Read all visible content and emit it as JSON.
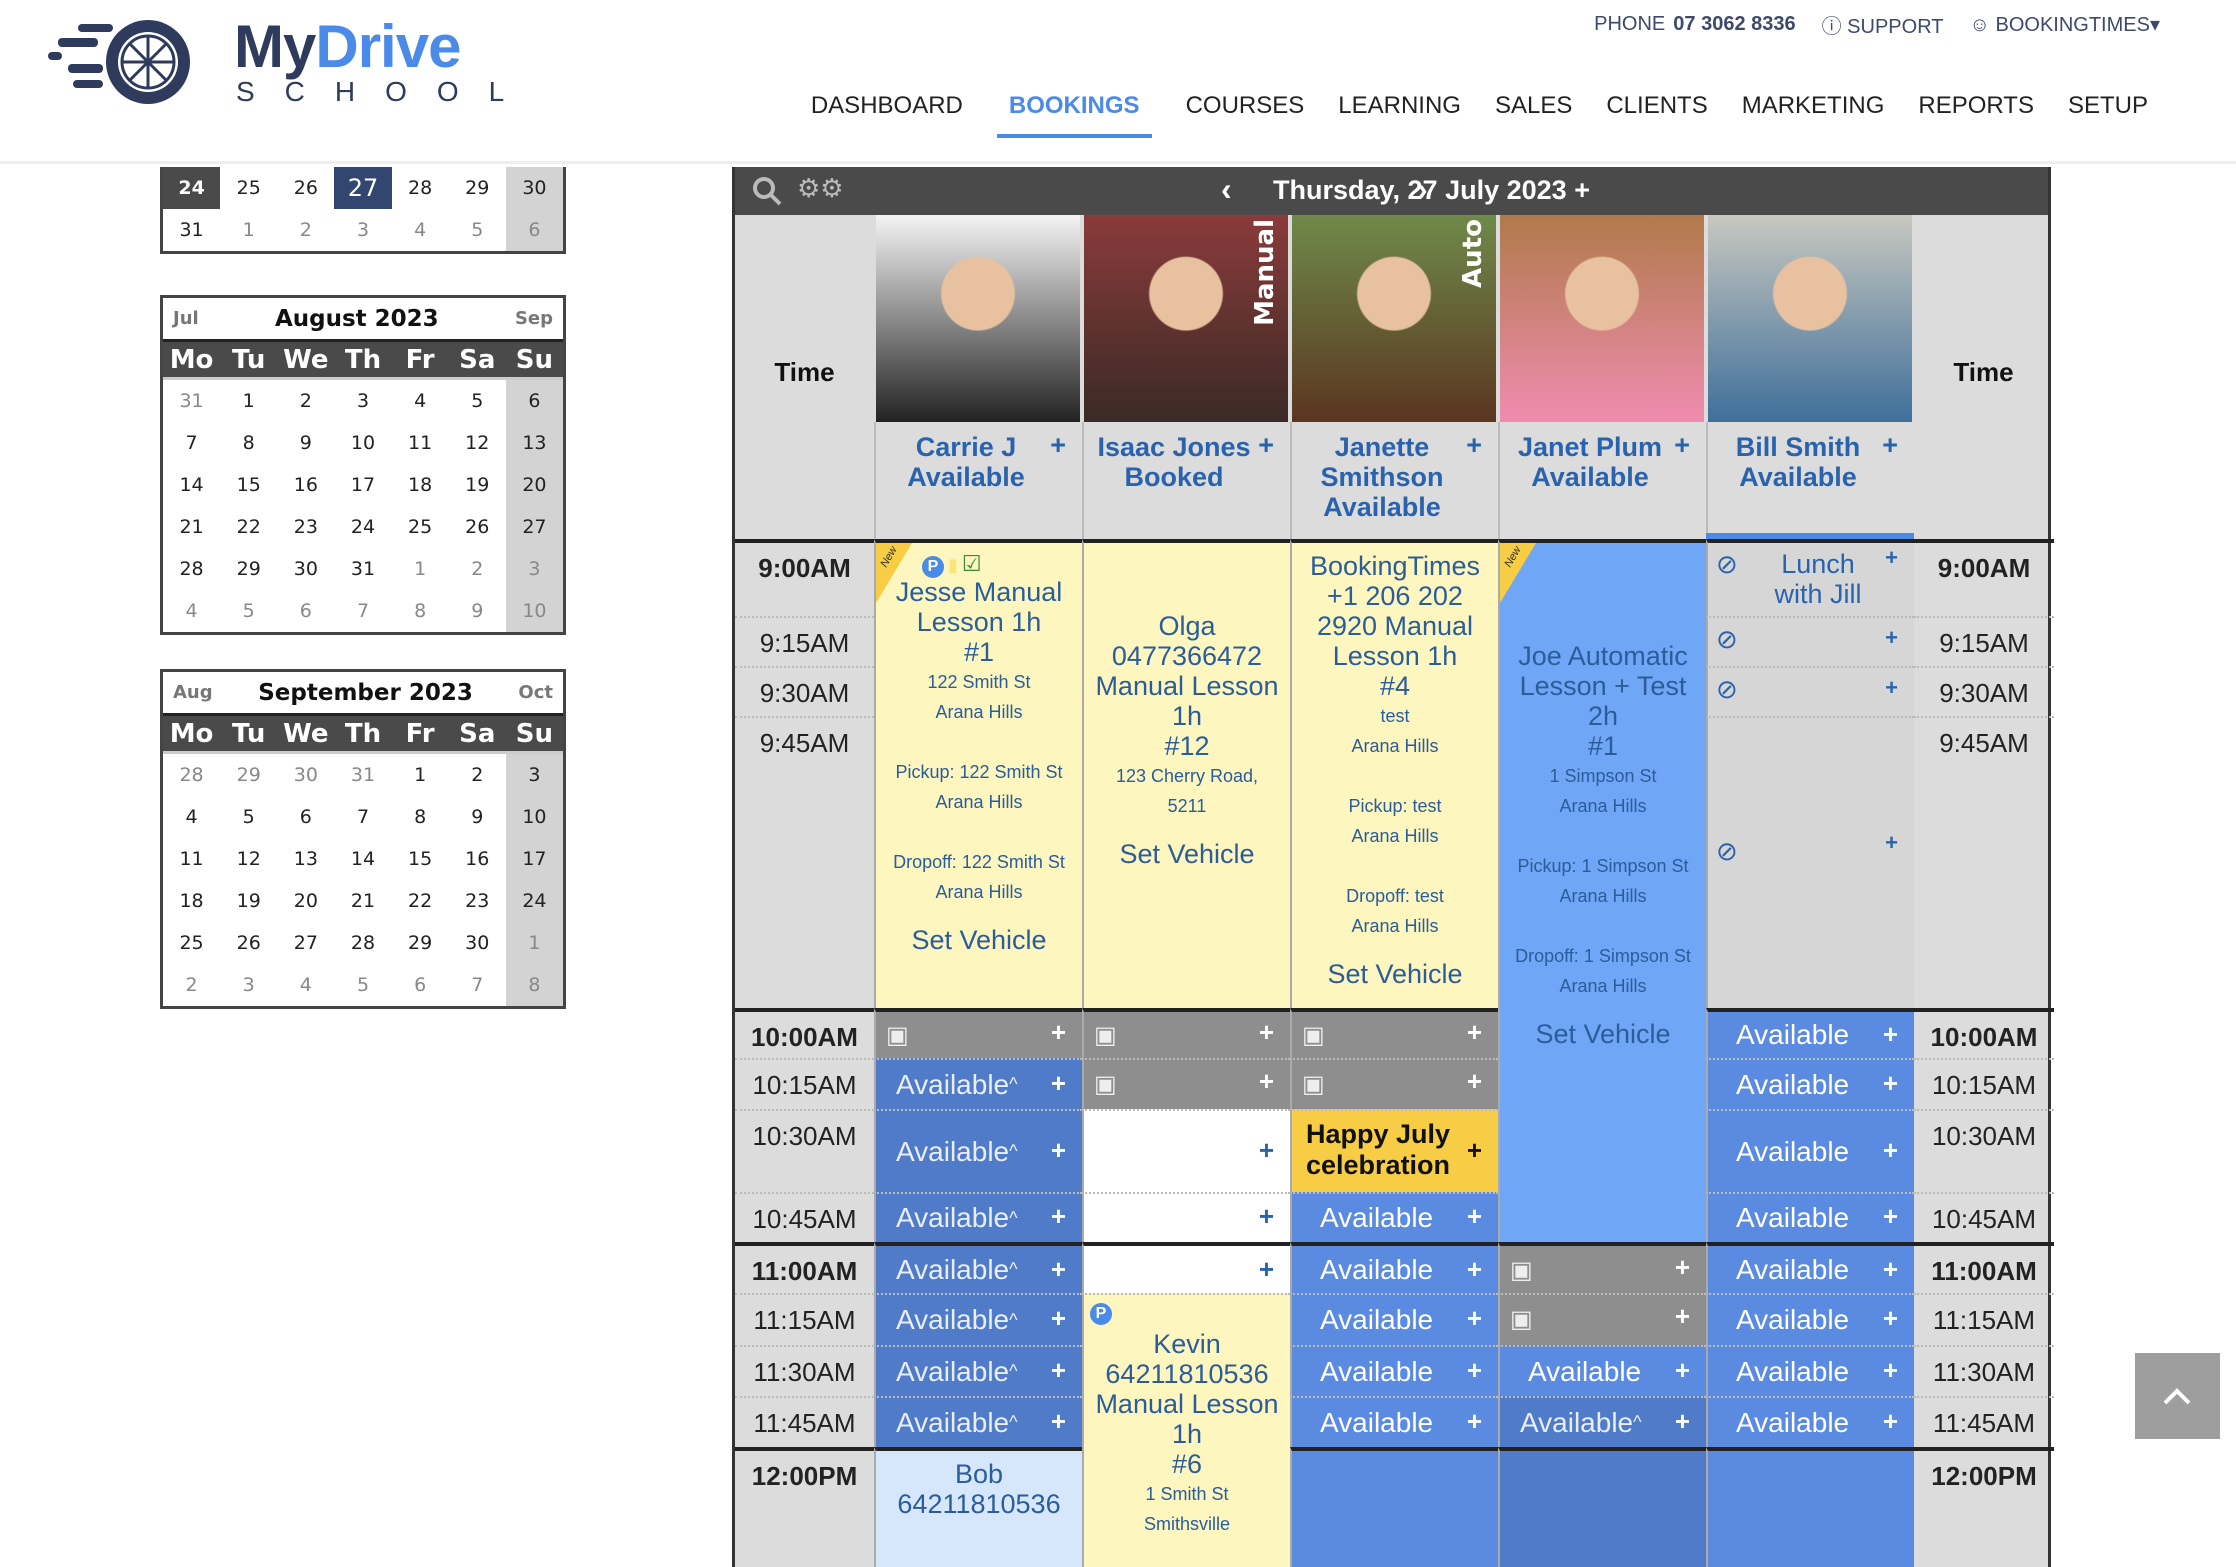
{
  "brand": {
    "name_part1": "My",
    "name_part2": "Drive",
    "subtitle": "SCHOOL",
    "accent": "#4a8ae8",
    "dark": "#2f3b5c"
  },
  "topbar": {
    "phone_label": "PHONE",
    "phone": "07 3062 8336",
    "support": "SUPPORT",
    "account": "BOOKINGTIMES"
  },
  "nav": [
    {
      "label": "DASHBOARD"
    },
    {
      "label": "BOOKINGS",
      "active": true
    },
    {
      "label": "COURSES"
    },
    {
      "label": "LEARNING"
    },
    {
      "label": "SALES"
    },
    {
      "label": "CLIENTS"
    },
    {
      "label": "MARKETING"
    },
    {
      "label": "REPORTS"
    },
    {
      "label": "SETUP"
    }
  ],
  "calendars": [
    {
      "title": "",
      "prev": "",
      "next": "",
      "weekdays": [],
      "weeks": [
        [
          24,
          25,
          26,
          27,
          28,
          29,
          30
        ],
        [
          31,
          1,
          2,
          3,
          4,
          5,
          6
        ]
      ],
      "leading_muted": 0,
      "trailing_muted": 6,
      "selected_week_day": 24,
      "today": 27
    },
    {
      "title": "August 2023",
      "prev": "Jul",
      "next": "Sep",
      "weekdays": [
        "Mo",
        "Tu",
        "We",
        "Th",
        "Fr",
        "Sa",
        "Su"
      ],
      "weeks": [
        [
          31,
          1,
          2,
          3,
          4,
          5,
          6
        ],
        [
          7,
          8,
          9,
          10,
          11,
          12,
          13
        ],
        [
          14,
          15,
          16,
          17,
          18,
          19,
          20
        ],
        [
          21,
          22,
          23,
          24,
          25,
          26,
          27
        ],
        [
          28,
          29,
          30,
          31,
          1,
          2,
          3
        ],
        [
          4,
          5,
          6,
          7,
          8,
          9,
          10
        ]
      ],
      "leading_muted": 1,
      "trailing_muted": 10
    },
    {
      "title": "September 2023",
      "prev": "Aug",
      "next": "Oct",
      "weekdays": [
        "Mo",
        "Tu",
        "We",
        "Th",
        "Fr",
        "Sa",
        "Su"
      ],
      "weeks": [
        [
          28,
          29,
          30,
          31,
          1,
          2,
          3
        ],
        [
          4,
          5,
          6,
          7,
          8,
          9,
          10
        ],
        [
          11,
          12,
          13,
          14,
          15,
          16,
          17
        ],
        [
          18,
          19,
          20,
          21,
          22,
          23,
          24
        ],
        [
          25,
          26,
          27,
          28,
          29,
          30,
          1
        ],
        [
          2,
          3,
          4,
          5,
          6,
          7,
          8
        ]
      ],
      "leading_muted": 4,
      "trailing_muted": 8
    }
  ],
  "scheduler": {
    "date": "Thursday, 27 July 2023",
    "add": "+",
    "time_header": "Time",
    "times": [
      "9:00AM",
      "9:15AM",
      "9:30AM",
      "9:45AM",
      "10:00AM",
      "10:15AM",
      "10:30AM",
      "10:45AM",
      "11:00AM",
      "11:15AM",
      "11:30AM",
      "11:45AM",
      "12:00PM"
    ],
    "hour_times": [
      "9:00AM",
      "10:00AM",
      "11:00AM",
      "12:00PM"
    ],
    "instructors": [
      {
        "name": "Carrie J",
        "status": "Available",
        "tag": "",
        "photo_colors": [
          "#f4f4f4",
          "#222"
        ]
      },
      {
        "name": "Isaac Jones",
        "status": "Booked",
        "tag": "Manual",
        "photo_colors": [
          "#8a3b3b",
          "#3a2a25"
        ]
      },
      {
        "name": "Janette Smithson",
        "status": "Available",
        "tag": "Auto",
        "photo_colors": [
          "#6f8a4a",
          "#5a3520"
        ]
      },
      {
        "name": "Janet Plum",
        "status": "Available",
        "tag": "",
        "photo_colors": [
          "#b07a4a",
          "#f08cb0"
        ]
      },
      {
        "name": "Bill Smith",
        "status": "Available",
        "tag": "",
        "photo_colors": [
          "#c8c8c0",
          "#3f6f9a"
        ],
        "selected": true
      }
    ],
    "columns": [
      [
        {
          "type": "booking",
          "start": "9:00AM",
          "end": "10:00AM",
          "new": true,
          "badges": [
            "P",
            "note",
            "check"
          ],
          "title": [
            "Jesse Manual Lesson 1h",
            "#1"
          ],
          "details": [
            "122 Smith St",
            "Arana Hills",
            "",
            "Pickup: 122 Smith St",
            "Arana Hills",
            "",
            "Dropoff: 122 Smith St",
            "Arana Hills"
          ],
          "link": "Set Vehicle"
        },
        {
          "type": "unavailable",
          "start": "10:00AM",
          "end": "10:15AM"
        },
        {
          "type": "available-alt",
          "start": "10:15AM",
          "end": "10:30AM",
          "label": "Available"
        },
        {
          "type": "available-alt",
          "start": "10:30AM",
          "end": "10:45AM",
          "label": "Available"
        },
        {
          "type": "available-alt",
          "start": "10:45AM",
          "end": "11:00AM",
          "label": "Available"
        },
        {
          "type": "available-alt",
          "start": "11:00AM",
          "end": "11:15AM",
          "label": "Available"
        },
        {
          "type": "available-alt",
          "start": "11:15AM",
          "end": "11:30AM",
          "label": "Available"
        },
        {
          "type": "available-alt",
          "start": "11:30AM",
          "end": "11:45AM",
          "label": "Available"
        },
        {
          "type": "available-alt",
          "start": "11:45AM",
          "end": "12:00PM",
          "label": "Available"
        },
        {
          "type": "booking-light",
          "start": "12:00PM",
          "end": "",
          "title": [
            "Bob",
            "64211810536"
          ],
          "details": []
        }
      ],
      [
        {
          "type": "booking",
          "start": "9:00AM",
          "end": "10:00AM",
          "title": [
            "",
            "",
            "Olga",
            "0477366472",
            "Manual Lesson 1h",
            "#12"
          ],
          "details": [
            "123 Cherry Road,",
            "5211"
          ],
          "link": "Set Vehicle"
        },
        {
          "type": "unavailable",
          "start": "10:00AM",
          "end": "10:15AM"
        },
        {
          "type": "unavailable",
          "start": "10:15AM",
          "end": "10:30AM"
        },
        {
          "type": "free",
          "start": "10:30AM",
          "end": "10:45AM"
        },
        {
          "type": "free",
          "start": "10:45AM",
          "end": "11:00AM"
        },
        {
          "type": "free",
          "start": "11:00AM",
          "end": "11:15AM"
        },
        {
          "type": "booking",
          "start": "11:15AM",
          "end": "",
          "badges": [
            "P"
          ],
          "title": [
            "Kevin",
            "64211810536",
            "Manual Lesson 1h",
            "#6"
          ],
          "details": [
            "1 Smith St",
            "Smithsville"
          ]
        }
      ],
      [
        {
          "type": "booking",
          "start": "9:00AM",
          "end": "10:00AM",
          "title": [
            "BookingTimes +1 206 202 2920 Manual Lesson 1h",
            "#4"
          ],
          "details": [
            "test",
            "Arana Hills",
            "",
            "Pickup: test",
            "Arana Hills",
            "",
            "Dropoff: test",
            "Arana Hills"
          ],
          "link": "Set Vehicle"
        },
        {
          "type": "unavailable",
          "start": "10:00AM",
          "end": "10:15AM"
        },
        {
          "type": "unavailable",
          "start": "10:15AM",
          "end": "10:30AM"
        },
        {
          "type": "event",
          "start": "10:30AM",
          "end": "10:45AM",
          "label": "Happy July celebration"
        },
        {
          "type": "available",
          "start": "10:45AM",
          "end": "11:00AM",
          "label": "Available"
        },
        {
          "type": "available",
          "start": "11:00AM",
          "end": "11:15AM",
          "label": "Available"
        },
        {
          "type": "available",
          "start": "11:15AM",
          "end": "11:30AM",
          "label": "Available"
        },
        {
          "type": "available",
          "start": "11:30AM",
          "end": "11:45AM",
          "label": "Available"
        },
        {
          "type": "available",
          "start": "11:45AM",
          "end": "12:00PM",
          "label": "Available"
        },
        {
          "type": "empty",
          "start": "12:00PM",
          "end": ""
        }
      ],
      [
        {
          "type": "booking-blue",
          "start": "9:00AM",
          "end": "11:00AM",
          "new": true,
          "title": [
            "",
            "",
            "",
            "Joe Automatic Lesson + Test 2h",
            "#1"
          ],
          "details": [
            "1 Simpson St",
            "Arana Hills",
            "",
            "Pickup: 1 Simpson St",
            "Arana Hills",
            "",
            "Dropoff: 1 Simpson St",
            "Arana Hills"
          ],
          "link": "Set Vehicle"
        },
        {
          "type": "unavailable",
          "start": "11:00AM",
          "end": "11:15AM"
        },
        {
          "type": "unavailable",
          "start": "11:15AM",
          "end": "11:30AM"
        },
        {
          "type": "available",
          "start": "11:30AM",
          "end": "11:45AM",
          "label": "Available"
        },
        {
          "type": "available-alt",
          "start": "11:45AM",
          "end": "12:00PM",
          "label": "Available"
        },
        {
          "type": "empty-dark",
          "start": "12:00PM",
          "end": ""
        }
      ],
      [
        {
          "type": "break",
          "start": "9:00AM",
          "end": "9:15AM",
          "label": "Lunch with Jill"
        },
        {
          "type": "break",
          "start": "9:15AM",
          "end": "9:30AM",
          "label": ""
        },
        {
          "type": "break",
          "start": "9:30AM",
          "end": "9:45AM",
          "label": ""
        },
        {
          "type": "break",
          "start": "9:45AM",
          "end": "10:00AM",
          "label": ""
        },
        {
          "type": "available",
          "start": "10:00AM",
          "end": "10:15AM",
          "label": "Available"
        },
        {
          "type": "available",
          "start": "10:15AM",
          "end": "10:30AM",
          "label": "Available"
        },
        {
          "type": "available",
          "start": "10:30AM",
          "end": "10:45AM",
          "label": "Available"
        },
        {
          "type": "available",
          "start": "10:45AM",
          "end": "11:00AM",
          "label": "Available"
        },
        {
          "type": "available",
          "start": "11:00AM",
          "end": "11:15AM",
          "label": "Available"
        },
        {
          "type": "available",
          "start": "11:15AM",
          "end": "11:30AM",
          "label": "Available"
        },
        {
          "type": "available",
          "start": "11:30AM",
          "end": "11:45AM",
          "label": "Available"
        },
        {
          "type": "available",
          "start": "11:45AM",
          "end": "12:00PM",
          "label": "Available"
        },
        {
          "type": "empty",
          "start": "12:00PM",
          "end": ""
        }
      ]
    ]
  },
  "colors": {
    "available": "#5b8be0",
    "available_alt": "#4f7bc9",
    "booking": "#fdf6bf",
    "booking_blue": "#70a6f6",
    "event": "#f6cd45",
    "unavailable": "#8e8e8e",
    "toolbar": "#4a4a4a",
    "today": "#33466f"
  }
}
